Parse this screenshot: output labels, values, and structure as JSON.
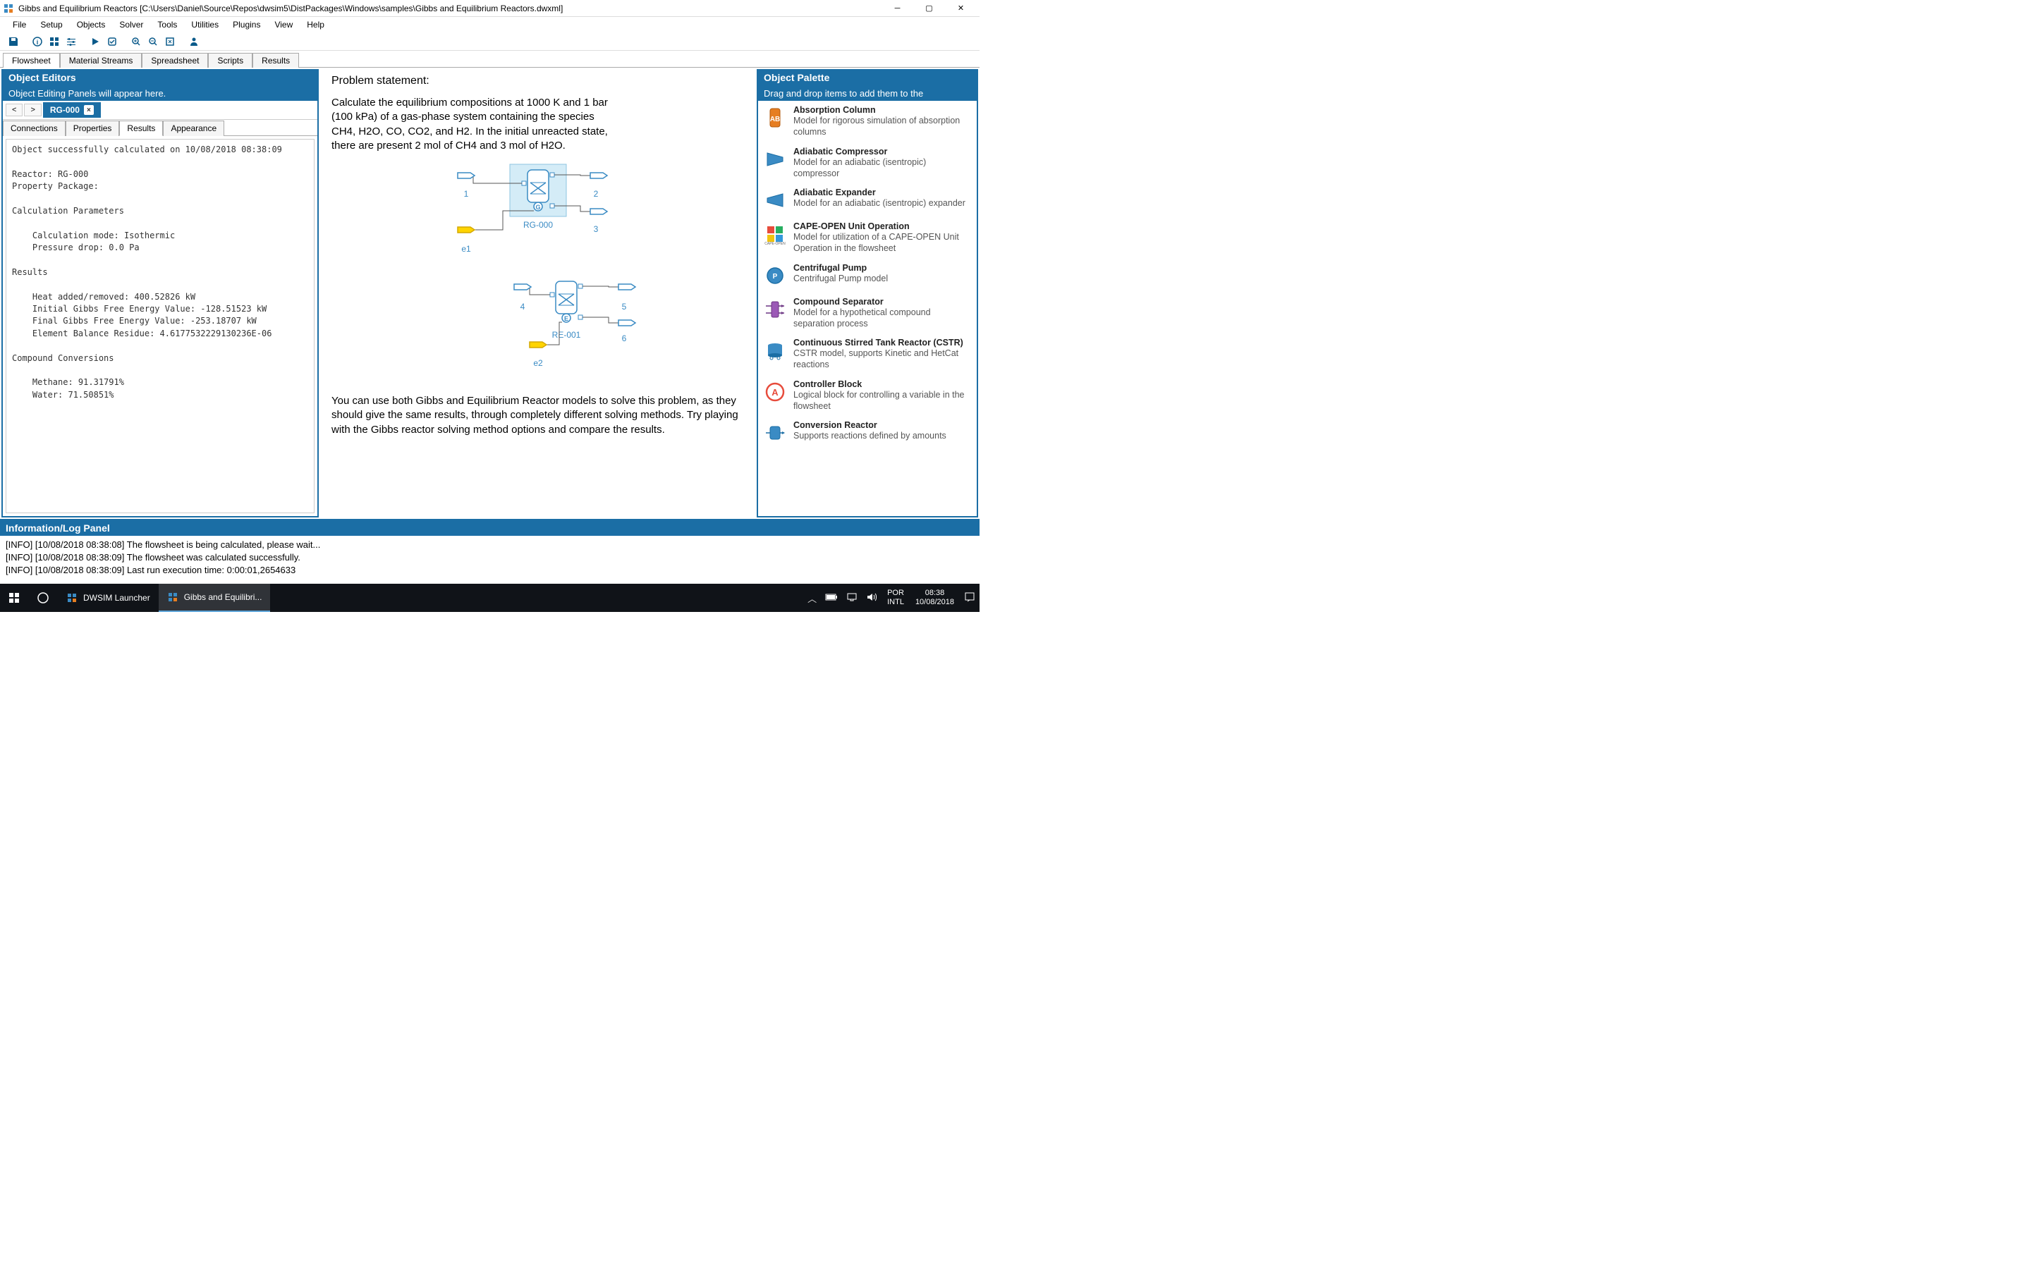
{
  "window": {
    "title": "Gibbs and Equilibrium Reactors [C:\\Users\\Daniel\\Source\\Repos\\dwsim5\\DistPackages\\Windows\\samples\\Gibbs and Equilibrium Reactors.dwxml]"
  },
  "menubar": [
    "File",
    "Setup",
    "Objects",
    "Solver",
    "Tools",
    "Utilities",
    "Plugins",
    "View",
    "Help"
  ],
  "doc_tabs": [
    "Flowsheet",
    "Material Streams",
    "Spreadsheet",
    "Scripts",
    "Results"
  ],
  "doc_active": 0,
  "left": {
    "header": "Object Editors",
    "sub": "Object Editing Panels will appear here.",
    "obj_name": "RG-000",
    "inner_tabs": [
      "Connections",
      "Properties",
      "Results",
      "Appearance"
    ],
    "inner_active": 2,
    "results_text": "Object successfully calculated on 10/08/2018 08:38:09\n\nReactor: RG-000\nProperty Package:\n\nCalculation Parameters\n\n    Calculation mode: Isothermic\n    Pressure drop: 0.0 Pa\n\nResults\n\n    Heat added/removed: 400.52826 kW\n    Initial Gibbs Free Energy Value: -128.51523 kW\n    Final Gibbs Free Energy Value: -253.18707 kW\n    Element Balance Residue: 4.6177532229130236E-06\n\nCompound Conversions\n\n    Methane: 91.31791%\n    Water: 71.50851%"
  },
  "center": {
    "problem_title": "Problem statement:",
    "problem_text": "Calculate the equilibrium compositions at 1000 K and 1 bar (100 kPa) of a gas-phase system containing the species CH4, H2O, CO, CO2, and H2. In the initial unreacted state, there are present 2 mol of CH4 and 3 mol of H2O.",
    "bottom_text": "You can use both Gibbs and Equilibrium Reactor models to solve this problem, as they should give the same results, through completely different solving methods. Try playing with the Gibbs reactor solving method options and compare the results.",
    "reactor1": {
      "name": "RG-000",
      "letter": "G",
      "in": "1",
      "out1": "2",
      "out2": "3",
      "energy": "e1"
    },
    "reactor2": {
      "name": "RE-001",
      "letter": "E",
      "in": "4",
      "out1": "5",
      "out2": "6",
      "energy": "e2"
    }
  },
  "right": {
    "header": "Object Palette",
    "sub": "Drag and drop items to add them to the",
    "items": [
      {
        "title": "Absorption Column",
        "desc": "Model for rigorous simulation of absorption columns",
        "icon": "absorption"
      },
      {
        "title": "Adiabatic Compressor",
        "desc": "Model for an adiabatic (isentropic) compressor",
        "icon": "compressor"
      },
      {
        "title": "Adiabatic Expander",
        "desc": "Model for an adiabatic (isentropic) expander",
        "icon": "expander"
      },
      {
        "title": "CAPE-OPEN Unit Operation",
        "desc": "Model for utilization of a CAPE-OPEN Unit Operation in the flowsheet",
        "icon": "cape"
      },
      {
        "title": "Centrifugal Pump",
        "desc": "Centrifugal Pump model",
        "icon": "pump"
      },
      {
        "title": "Compound Separator",
        "desc": "Model for a hypothetical compound separation process",
        "icon": "separator"
      },
      {
        "title": "Continuous Stirred Tank Reactor (CSTR)",
        "desc": "CSTR model, supports Kinetic and HetCat reactions",
        "icon": "cstr"
      },
      {
        "title": "Controller Block",
        "desc": "Logical block for controlling a variable in the flowsheet",
        "icon": "controller"
      },
      {
        "title": "Conversion Reactor",
        "desc": "Supports reactions defined by amounts",
        "icon": "conversion"
      }
    ]
  },
  "log": {
    "header": "Information/Log Panel",
    "lines": [
      "[INFO] [10/08/2018 08:38:08] The flowsheet is being calculated, please wait...",
      "[INFO] [10/08/2018 08:38:09] The flowsheet was calculated successfully.",
      "[INFO] [10/08/2018 08:38:09] Last run execution time: 0:00:01,2654633"
    ]
  },
  "taskbar": {
    "apps": [
      {
        "label": "DWSIM Launcher",
        "active": false
      },
      {
        "label": "Gibbs and Equilibri...",
        "active": true
      }
    ],
    "lang": "POR",
    "ime": "INTL",
    "time": "08:38",
    "date": "10/08/2018"
  }
}
